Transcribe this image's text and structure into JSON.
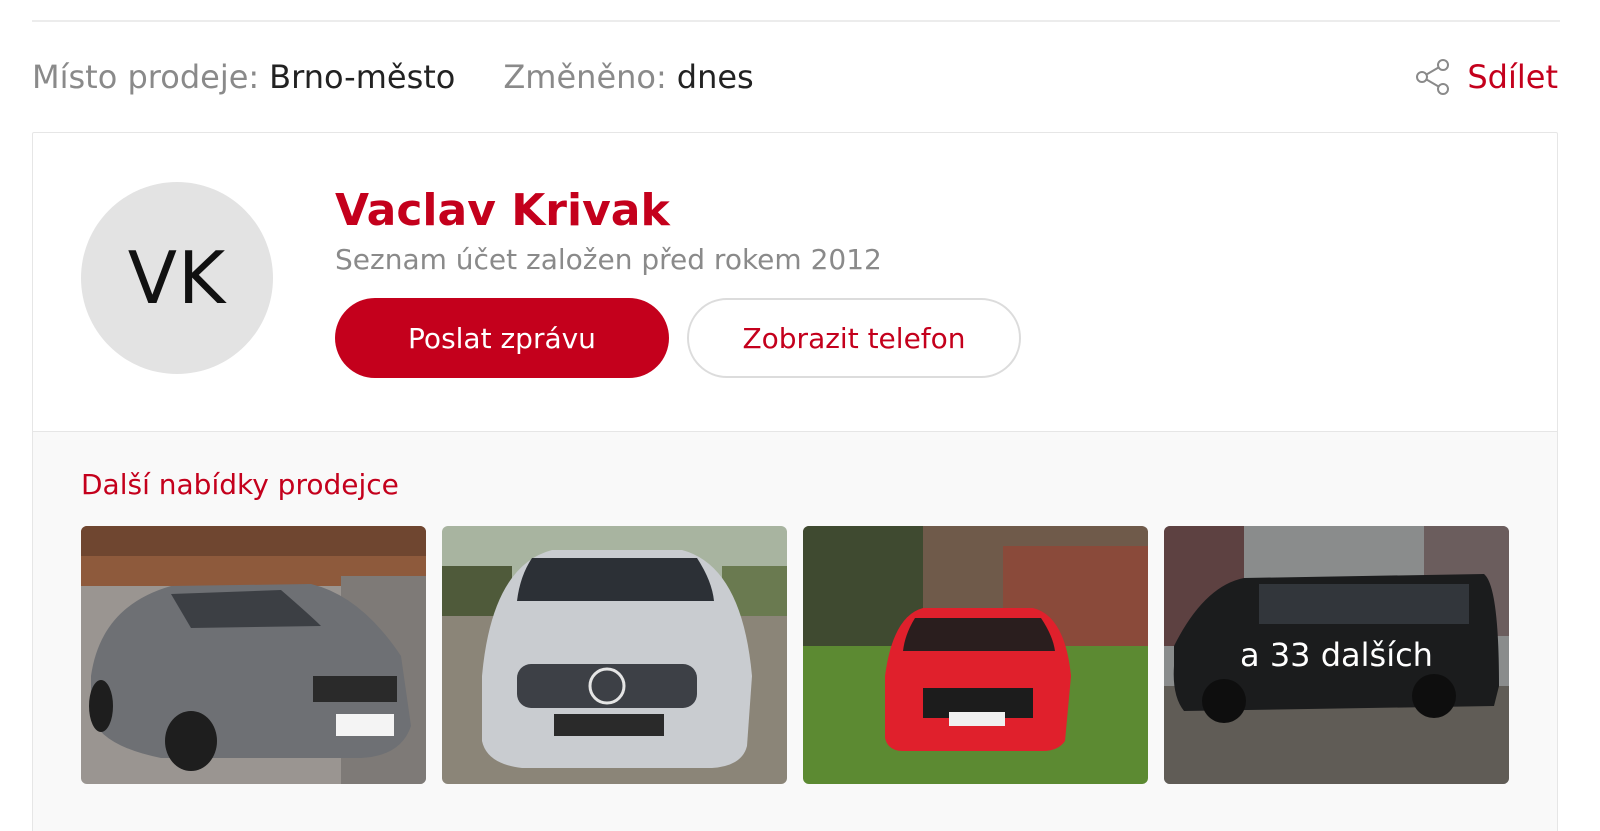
{
  "meta": {
    "location_label": "Místo prodeje:",
    "location_value": "Brno-město",
    "changed_label": "Změněno:",
    "changed_value": "dnes"
  },
  "share": {
    "label": "Sdílet",
    "icon": "share-icon"
  },
  "seller": {
    "initials": "VK",
    "name": "Vaclav Krivak",
    "since": "Seznam účet založen před rokem 2012",
    "send_message_label": "Poslat zprávu",
    "show_phone_label": "Zobrazit telefon"
  },
  "offers": {
    "title": "Další nabídky prodejce",
    "more_label": "a 33 dalších",
    "items": [
      {
        "icon": "car-photo-grey-mercedes-cla"
      },
      {
        "icon": "car-photo-silver-mercedes-b"
      },
      {
        "icon": "car-photo-red-honda-civic"
      },
      {
        "icon": "car-photo-black-van"
      }
    ]
  },
  "colors": {
    "accent": "#c4001c",
    "muted": "#8a8a8a",
    "avatar_bg": "#e3e3e3"
  }
}
